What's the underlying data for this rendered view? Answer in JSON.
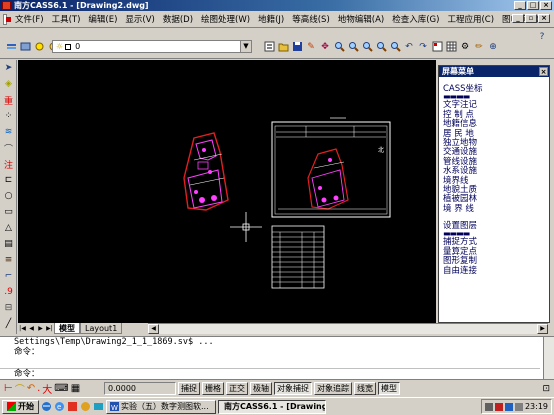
{
  "window": {
    "title": "南方CASS6.1 - [Drawing2.dwg]"
  },
  "menu": {
    "items": [
      "文件(F)",
      "工具(T)",
      "编辑(E)",
      "显示(V)",
      "数据(D)",
      "绘图处理(W)",
      "地籍(J)",
      "等高线(S)",
      "地物编辑(A)",
      "检查入库(G)",
      "工程应用(C)",
      "图幅管理(M)"
    ]
  },
  "toolbar": {
    "layer_value": "0"
  },
  "tabs": {
    "model": "模型",
    "layout": "Layout1"
  },
  "screen_menu": {
    "title": "屏幕菜单",
    "group1": [
      "CASS坐标"
    ],
    "group2": [
      "文字注记",
      "控 制 点",
      "地籍信息",
      "居 民 地",
      "独立地物",
      "交通设施",
      "管线设施",
      "水系设施",
      "境界线",
      "地貌土质",
      "植被园林",
      "境 界 线"
    ],
    "group3": [
      "设置图层"
    ],
    "group4": [
      "捕捉方式",
      "量算定点",
      "图形复制",
      "自由连接"
    ]
  },
  "command": {
    "history_1": "Settings\\Temp\\Drawing2_1_1_1869.sv$ ...",
    "history_2": "命令：",
    "prompt": "命令："
  },
  "status": {
    "coordinate": "0.0000",
    "buttons": [
      "捕捉",
      "栅格",
      "正交",
      "极轴",
      "对象捕捉",
      "对象追踪",
      "线宽",
      "模型"
    ]
  },
  "taskbar": {
    "start": "开始",
    "tasks": [
      "实验（五）数字测图软...",
      "南方CASS6.1 - [Drawing..."
    ],
    "clock": "23:19"
  }
}
